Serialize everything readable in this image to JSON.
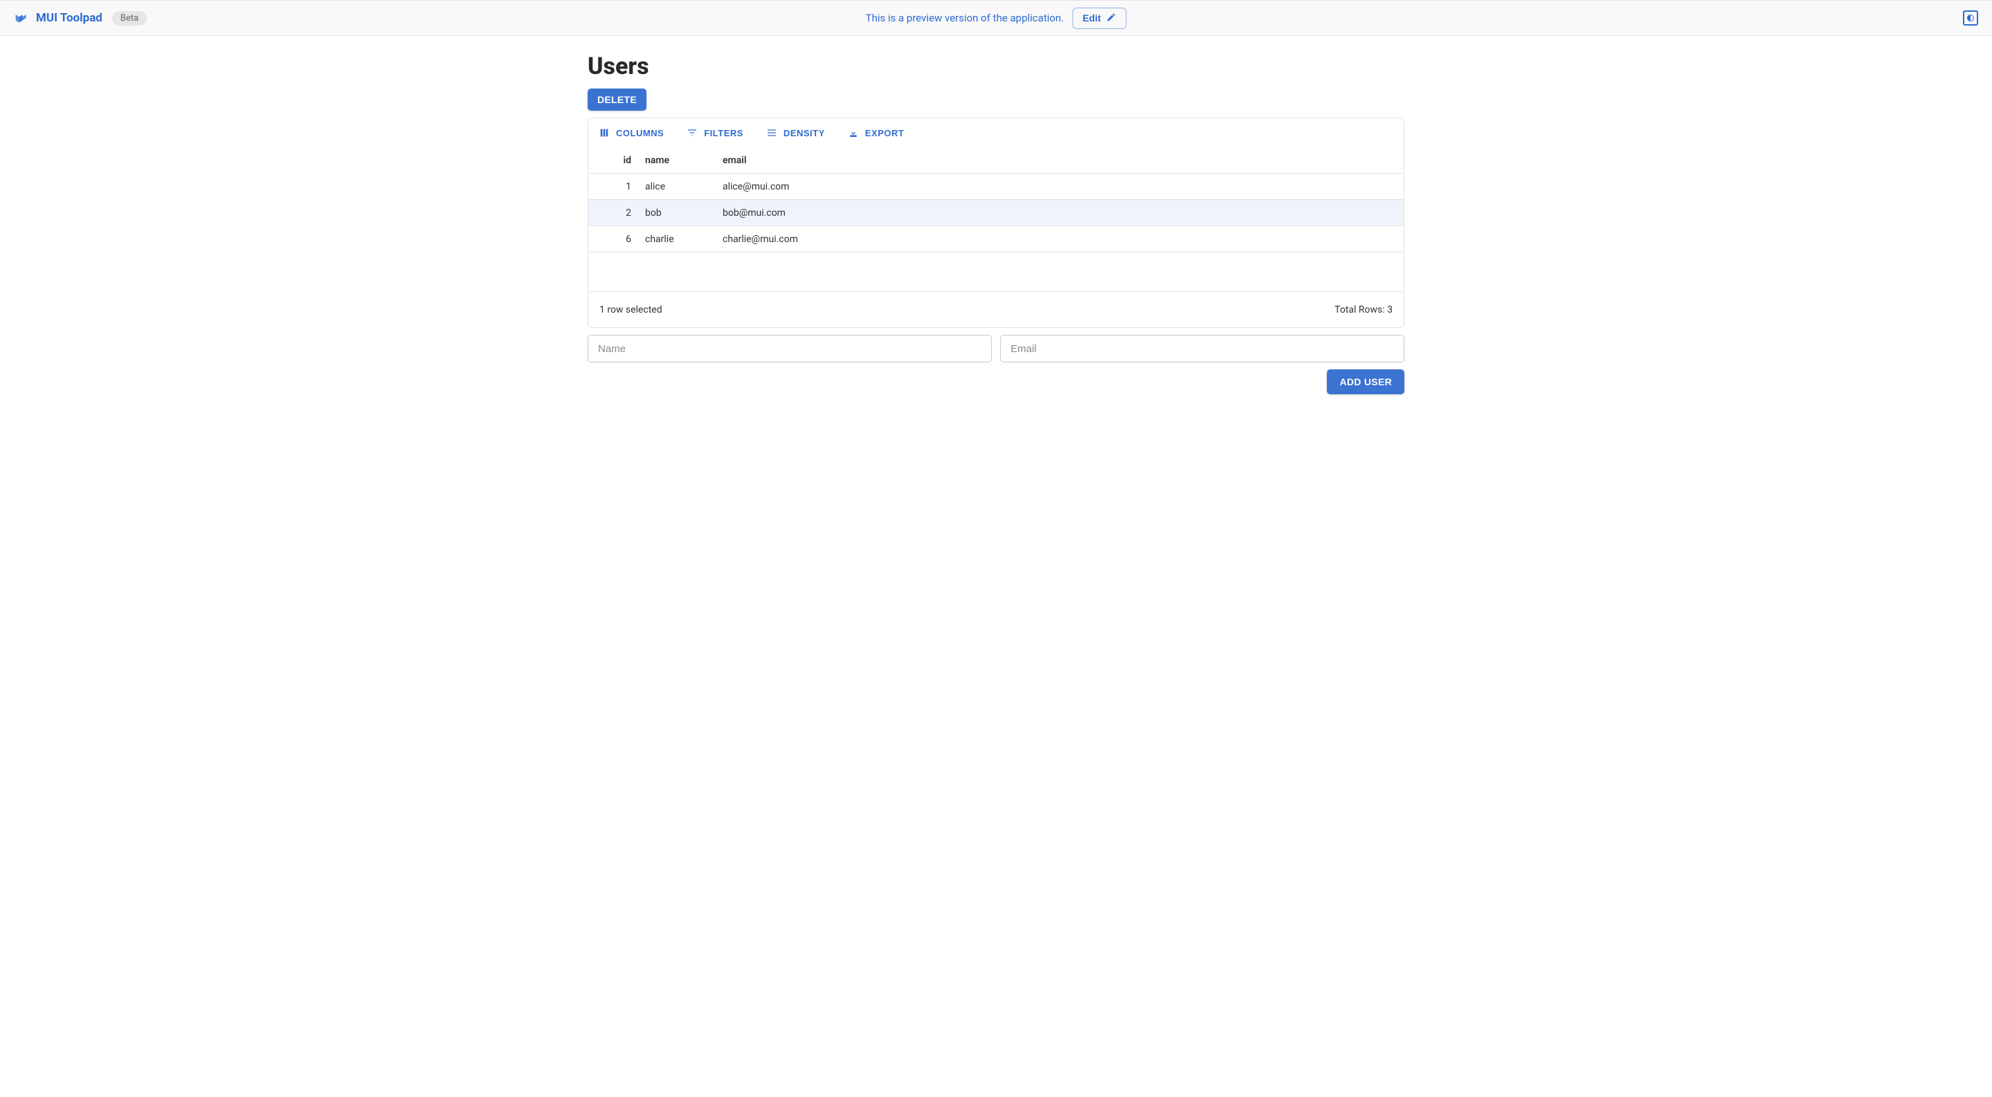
{
  "header": {
    "brand": "MUI Toolpad",
    "badge": "Beta",
    "preview_message": "This is a preview version of the application.",
    "edit_label": "Edit"
  },
  "page": {
    "title": "Users",
    "delete_label": "DELETE"
  },
  "grid": {
    "toolbar": {
      "columns": "COLUMNS",
      "filters": "FILTERS",
      "density": "DENSITY",
      "export": "EXPORT"
    },
    "columns": {
      "id": "id",
      "name": "name",
      "email": "email"
    },
    "rows": [
      {
        "id": "1",
        "name": "alice",
        "email": "alice@mui.com",
        "selected": false
      },
      {
        "id": "2",
        "name": "bob",
        "email": "bob@mui.com",
        "selected": true
      },
      {
        "id": "6",
        "name": "charlie",
        "email": "charlie@mui.com",
        "selected": false
      }
    ],
    "footer": {
      "selected_text": "1 row selected",
      "total_text": "Total Rows: 3"
    }
  },
  "form": {
    "name_placeholder": "Name",
    "email_placeholder": "Email",
    "add_user_label": "ADD USER"
  }
}
